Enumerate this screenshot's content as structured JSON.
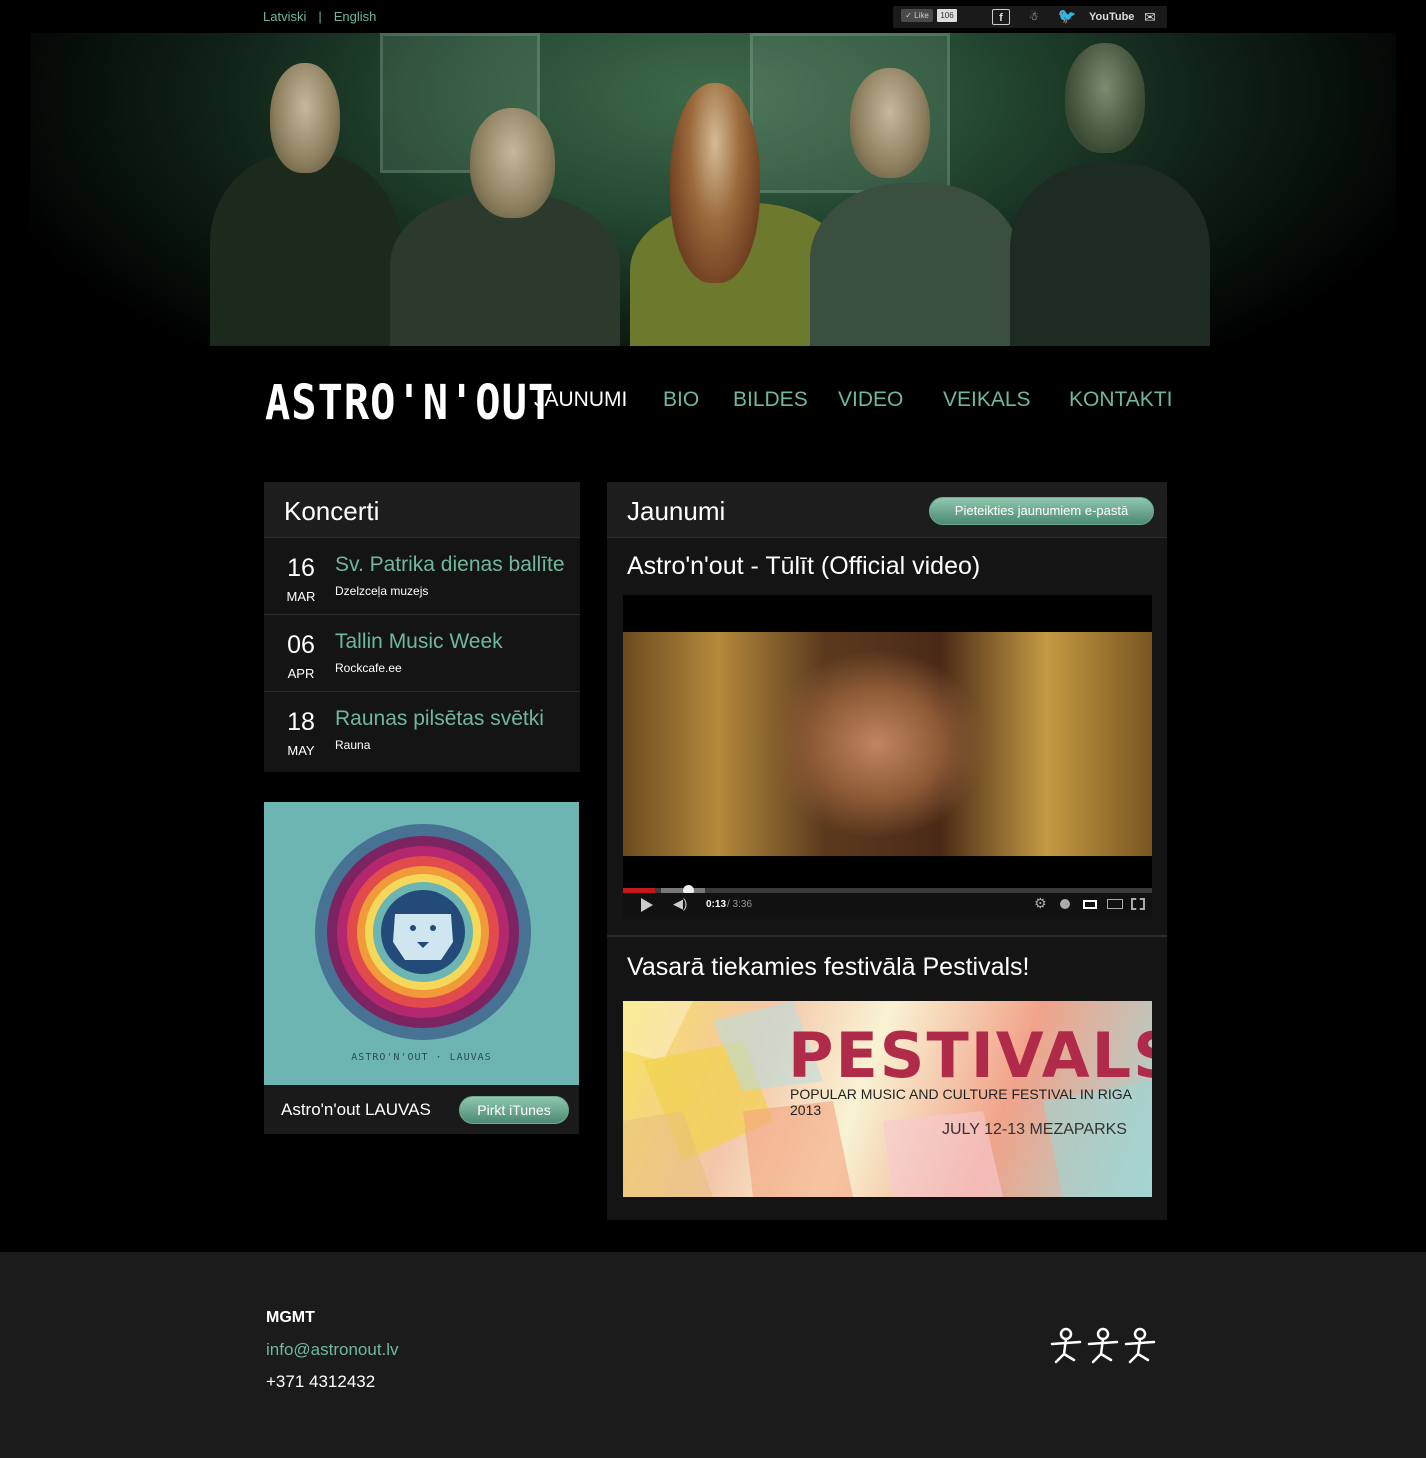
{
  "lang": {
    "lv": "Latviski",
    "sep": "|",
    "en": "English"
  },
  "social": {
    "like_label": "Like",
    "like_count": "106",
    "youtube": "YouTube"
  },
  "nav": {
    "logo": "ASTRO'N'OUT",
    "items": [
      "JAUNUMI",
      "BIO",
      "BILDES",
      "VIDEO",
      "VEIKALS",
      "KONTAKTI"
    ]
  },
  "concerts": {
    "title": "Koncerti",
    "items": [
      {
        "day": "16",
        "month": "MAR",
        "title": "Sv. Patrika dienas ballīte",
        "place": "Dzelzceļa muzejs"
      },
      {
        "day": "06",
        "month": "APR",
        "title": "Tallin Music Week",
        "place": "Rockcafe.ee"
      },
      {
        "day": "18",
        "month": "MAY",
        "title": "Raunas pilsētas svētki",
        "place": "Rauna"
      }
    ]
  },
  "album": {
    "cover_text": "ASTRO'N'OUT · LAUVAS",
    "name": "Astro'n'out LAUVAS",
    "buy_label": "Pirkt iTunes"
  },
  "news": {
    "title": "Jaunumi",
    "subscribe_label": "Pieteikties jaunumiem e-pastā",
    "post1_title": "Astro'n'out - Tūlīt (Official video)",
    "video_time": "0:13",
    "video_duration": "/ 3:36",
    "video_progress": 0.06,
    "post2_title": "Vasarā tiekamies festivālā Pestivals!",
    "fest_word": "PESTIVALS",
    "fest_sub": "POPULAR MUSIC AND CULTURE FESTIVAL IN RIGA 2013",
    "fest_date": "JULY 12-13 MEZAPARKS"
  },
  "footer": {
    "label": "MGMT",
    "email": "info@astronout.lv",
    "phone": "+371 4312432"
  },
  "colors": {
    "accent": "#6fb89c",
    "panel": "#141414",
    "footer": "#1b1b1b"
  }
}
